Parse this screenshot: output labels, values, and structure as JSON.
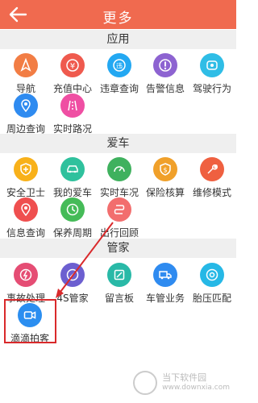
{
  "header": {
    "title": "更多"
  },
  "sections": [
    {
      "title": "应用",
      "items": [
        {
          "label": "导航",
          "icon": "navigation-icon",
          "color": "#f27d44"
        },
        {
          "label": "充值中心",
          "icon": "recharge-icon",
          "color": "#ef5a4e"
        },
        {
          "label": "违章查询",
          "icon": "violation-query-icon",
          "color": "#23a8f2"
        },
        {
          "label": "告警信息",
          "icon": "alert-icon",
          "color": "#8d63d1"
        },
        {
          "label": "驾驶行为",
          "icon": "driving-behavior-icon",
          "color": "#2fbde6"
        },
        {
          "label": "周边查询",
          "icon": "nearby-icon",
          "color": "#2f8bf0"
        },
        {
          "label": "实时路况",
          "icon": "traffic-icon",
          "color": "#ef4fa3"
        }
      ]
    },
    {
      "title": "爱车",
      "items": [
        {
          "label": "安全卫士",
          "icon": "security-icon",
          "color": "#f8b11a"
        },
        {
          "label": "我的爱车",
          "icon": "my-car-icon",
          "color": "#2fc19d"
        },
        {
          "label": "实时车况",
          "icon": "car-status-icon",
          "color": "#3fb15e"
        },
        {
          "label": "保险核算",
          "icon": "insurance-icon",
          "color": "#f0a02a"
        },
        {
          "label": "维修模式",
          "icon": "repair-icon",
          "color": "#ef6040"
        },
        {
          "label": "信息查询",
          "icon": "info-query-icon",
          "color": "#ef4f4f"
        },
        {
          "label": "保养周期",
          "icon": "maintenance-icon",
          "color": "#45bb58"
        },
        {
          "label": "出行回顾",
          "icon": "trip-review-icon",
          "color": "#f26e6e"
        }
      ]
    },
    {
      "title": "管家",
      "items": [
        {
          "label": "事故处理",
          "icon": "accident-icon",
          "color": "#e54d74"
        },
        {
          "label": "4S管家",
          "icon": "4s-icon",
          "color": "#6c5fd0"
        },
        {
          "label": "留言板",
          "icon": "message-board-icon",
          "color": "#29b9a7"
        },
        {
          "label": "车管业务",
          "icon": "vehicle-admin-icon",
          "color": "#2f8bf0"
        },
        {
          "label": "胎压匹配",
          "icon": "tire-pressure-icon",
          "color": "#26b8e6"
        },
        {
          "label": "滴滴拍客",
          "icon": "didi-camera-icon",
          "color": "#2b8ef0"
        }
      ]
    }
  ],
  "watermark": {
    "line1": "当下软件园",
    "line2": "www.downxia.com"
  }
}
